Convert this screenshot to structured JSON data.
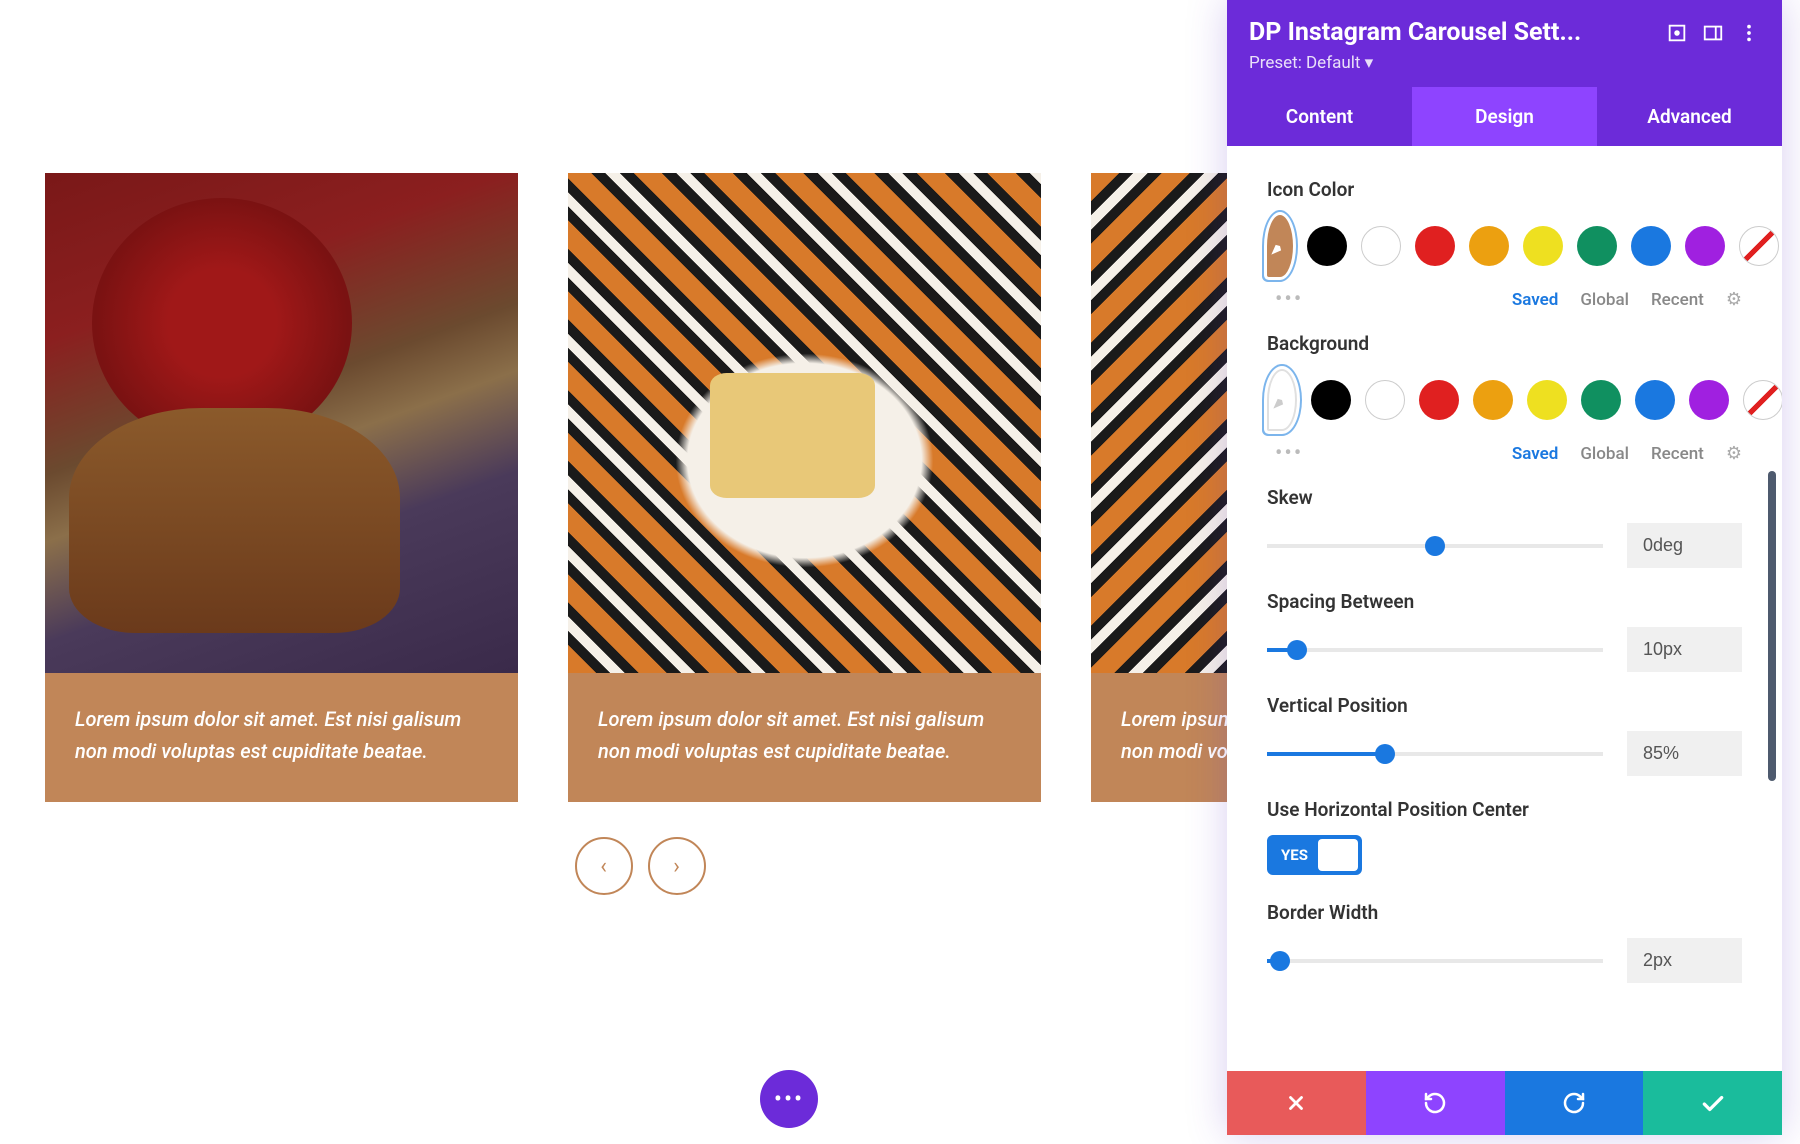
{
  "carousel": {
    "cards": [
      {
        "caption": "Lorem ipsum dolor sit amet. Est nisi galisum non modi voluptas est cupiditate beatae."
      },
      {
        "caption": "Lorem ipsum dolor sit amet. Est nisi galisum non modi voluptas est cupiditate beatae."
      },
      {
        "caption": "Lorem ipsum dolor sit amet. Est nisi galisum non modi voluptas est cupiditate beatae."
      }
    ],
    "nav": {
      "prev": "‹",
      "next": "›"
    }
  },
  "fab": {
    "glyph": "•••"
  },
  "panel": {
    "title": "DP Instagram Carousel Sett...",
    "preset": "Preset: Default ▾",
    "tabs": {
      "content": "Content",
      "design": "Design",
      "advanced": "Advanced"
    },
    "sections": {
      "icon_color": "Icon Color",
      "background": "Background",
      "skew": "Skew",
      "spacing": "Spacing Between",
      "vpos": "Vertical Position",
      "hcenter": "Use Horizontal Position Center",
      "border": "Border Width"
    },
    "picker_tabs": {
      "saved": "Saved",
      "global": "Global",
      "recent": "Recent"
    },
    "values": {
      "skew": "0deg",
      "spacing": "10px",
      "vpos": "85%",
      "border": "2px",
      "toggle": "YES"
    },
    "slider_pos": {
      "skew": 50,
      "spacing": 9,
      "vpos": 35,
      "border": 4
    },
    "colors": {
      "brand_purple": "#6c2bd9",
      "accent_purple": "#8e44ff",
      "accent_brown": "#c18658",
      "link_blue": "#1a78e0"
    }
  }
}
